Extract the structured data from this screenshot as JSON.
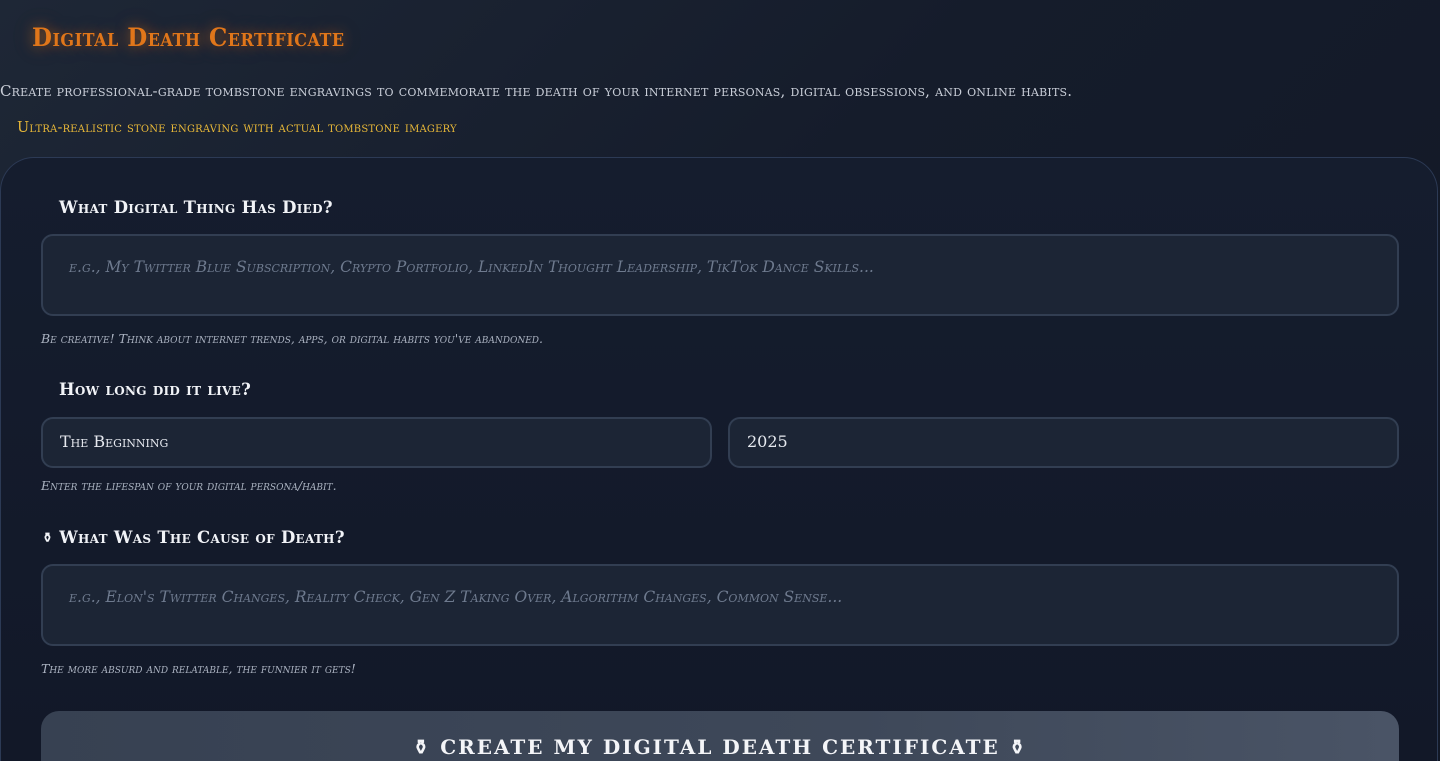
{
  "header": {
    "logo_text": "Digital Death Certificate",
    "subtitle": "Create professional-grade tombstone engravings to commemorate the death of your internet personas, digital obsessions, and online habits.",
    "badge": "Ultra-realistic stone engraving with actual tombstone imagery"
  },
  "form": {
    "thing": {
      "label": "What Digital Thing Has Died?",
      "placeholder": "e.g., My Twitter Blue Subscription, Crypto Portfolio, LinkedIn Thought Leadership, TikTok Dance Skills...",
      "hint": "Be creative! Think about internet trends, apps, or digital habits you've abandoned."
    },
    "lifespan": {
      "label": "How long did it live?",
      "start_value": "The Beginning",
      "end_value": "2025",
      "hint": "Enter the lifespan of your digital persona/habit."
    },
    "cause": {
      "icon": "urn-icon",
      "label": "What Was The Cause of Death?",
      "placeholder": "e.g., Elon's Twitter Changes, Reality Check, Gen Z Taking Over, Algorithm Changes, Common Sense...",
      "hint": "The more absurd and relatable, the funnier it gets!"
    },
    "submit": {
      "label": "⚱ CREATE MY DIGITAL DEATH CERTIFICATE ⚱"
    }
  },
  "colors": {
    "logo": "#e0761a",
    "badge": "#e8b838",
    "background": "#151c2b"
  }
}
